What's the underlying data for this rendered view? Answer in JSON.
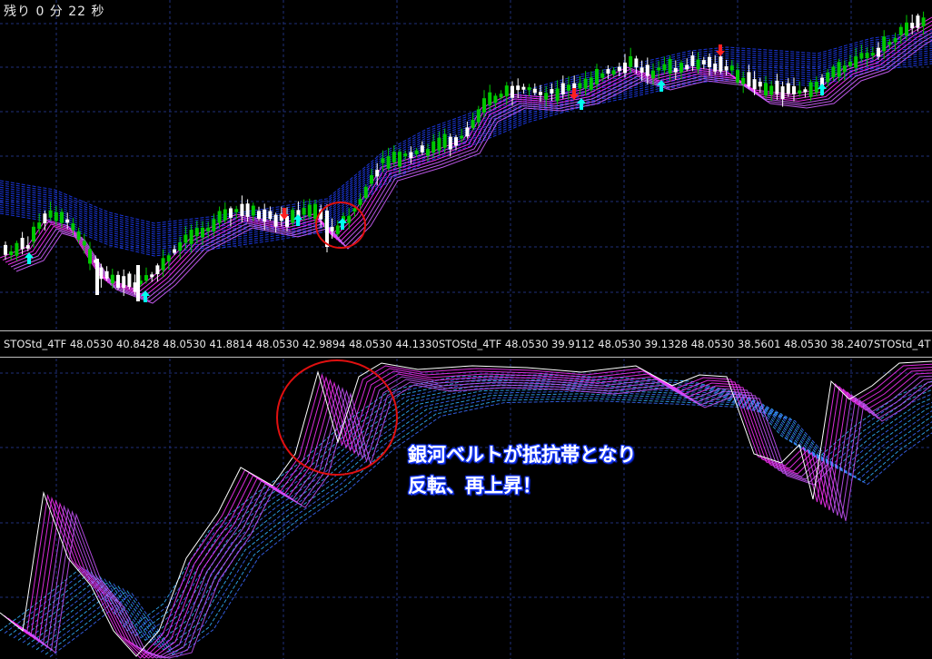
{
  "timer_text": "残り 0 分 22 秒",
  "indicator_bar": {
    "segments": [
      "STOStd_4TF 48.0530 40.8428 48.0530 41.8814 48.0530 42.9894 48.0530 44.1330",
      "STOStd_4TF 48.0530 39.9112 48.0530 39.1328 48.0530 38.5601 48.0530 38.2407",
      "STOStd_4T"
    ]
  },
  "annotation": {
    "line1": "銀河ベルトが抵抗帯となり",
    "line2": "反転、再上昇！"
  },
  "colors": {
    "background": "#000000",
    "grid": "#1f2f7a",
    "bull_candle": "#00c800",
    "bear_candle": "#ffffff",
    "magenta_band": "#ff33ff",
    "blue_belt": "#1f3fff",
    "cyan_belt": "#33b0ff",
    "buy_arrow": "#00ffee",
    "sell_arrow": "#ff2020",
    "highlight_circle": "#e01010"
  },
  "signals": {
    "buy_arrow_icon": "arrow-up-icon",
    "sell_arrow_icon": "arrow-down-icon"
  }
}
